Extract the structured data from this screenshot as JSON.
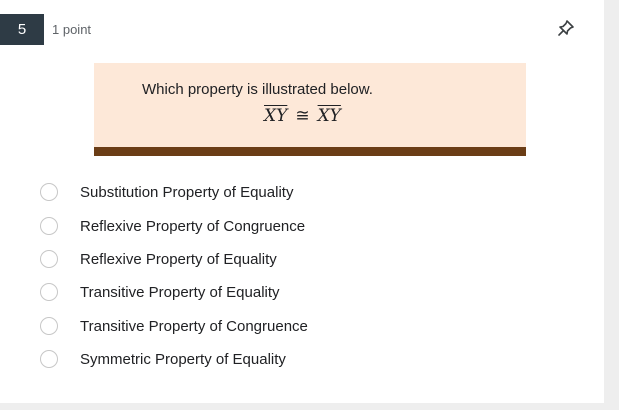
{
  "question": {
    "number": "5",
    "points": "1 point",
    "prompt": "Which property is illustrated below.",
    "expression": {
      "left": "XY",
      "relation": "≅",
      "right": "XY"
    }
  },
  "options": [
    "Substitution Property of Equality",
    "Reflexive Property of Congruence",
    "Reflexive Property of Equality",
    "Transitive Property of Equality",
    "Transitive Property of Congruence",
    "Symmetric Property of Equality"
  ],
  "icons": {
    "pin": "pin-icon",
    "radio": "radio-button"
  },
  "colors": {
    "number_badge": "#2e3b45",
    "prompt_background": "#fde8d8",
    "prompt_bar": "#6b3d16"
  }
}
